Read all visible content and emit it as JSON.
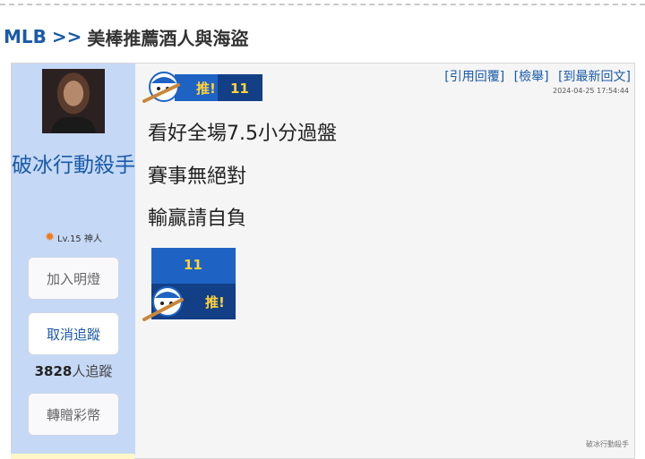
{
  "breadcrumb": {
    "category": "MLB",
    "separator": ">>",
    "title": "美棒推薦酒人與海盜"
  },
  "user": {
    "name": "破冰行動殺手",
    "level": "Lv.15 神人",
    "light_button": "加入明燈",
    "unfollow_button": "取消追蹤",
    "follower_count": "3828",
    "follower_suffix": "人追蹤",
    "gift_button": "轉贈彩幣"
  },
  "post": {
    "badge_label": "推!",
    "badge_number": "11",
    "actions": {
      "reply": "[引用回覆]",
      "report": "[檢舉]",
      "latest": "[到最新回文]"
    },
    "timestamp": "2024-04-25 17:54:44",
    "lines": [
      "看好全場7.5小分過盤",
      "賽事無絕對",
      "輸贏請自負"
    ],
    "signature": "破冰行動殺手"
  },
  "colors": {
    "accent": "#1a5aa8",
    "sidebar_bg": "#c5d8f5",
    "badge_bg": "#1e63c4"
  }
}
